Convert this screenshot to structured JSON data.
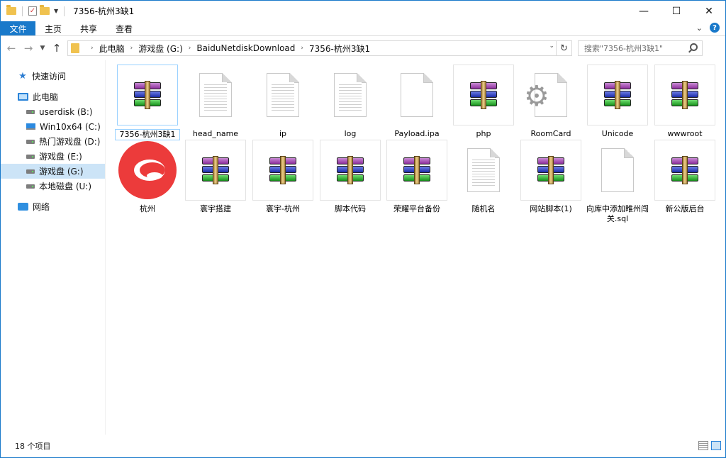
{
  "window": {
    "title": "7356-杭州3缺1",
    "controls": {
      "minimize": "—",
      "maximize": "☐",
      "close": "✕"
    }
  },
  "ribbon": {
    "tabs": [
      "文件",
      "主页",
      "共享",
      "查看"
    ],
    "expand_icon": "chevron-down-icon",
    "help": "?"
  },
  "address": {
    "crumbs": [
      "此电脑",
      "游戏盘 (G:)",
      "BaiduNetdiskDownload",
      "7356-杭州3缺1"
    ],
    "refresh_icon": "refresh-icon"
  },
  "search": {
    "placeholder": "搜索\"7356-杭州3缺1\""
  },
  "nav_pane": {
    "quick_access": "快速访问",
    "this_pc": "此电脑",
    "drives": [
      "userdisk (B:)",
      "Win10x64 (C:)",
      "热门游戏盘 (D:)",
      "游戏盘 (E:)",
      "游戏盘 (G:)",
      "本地磁盘 (U:)"
    ],
    "network": "网络"
  },
  "files": [
    {
      "name": "7356-杭州3缺1",
      "type": "rar"
    },
    {
      "name": "head_name",
      "type": "doc"
    },
    {
      "name": "ip",
      "type": "doc"
    },
    {
      "name": "log",
      "type": "doc"
    },
    {
      "name": "Payload.ipa",
      "type": "blank"
    },
    {
      "name": "php",
      "type": "rar"
    },
    {
      "name": "RoomCard",
      "type": "gear"
    },
    {
      "name": "Unicode",
      "type": "rar"
    },
    {
      "name": "wwwroot",
      "type": "rar"
    },
    {
      "name": "杭州",
      "type": "logo"
    },
    {
      "name": "寰宇搭建",
      "type": "rar"
    },
    {
      "name": "寰宇-杭州",
      "type": "rar"
    },
    {
      "name": "脚本代码",
      "type": "rar"
    },
    {
      "name": "荣耀平台备份",
      "type": "rar"
    },
    {
      "name": "随机名",
      "type": "doc"
    },
    {
      "name": "网站脚本(1)",
      "type": "rar"
    },
    {
      "name": "向库中添加睢州闯关.sql",
      "type": "blank"
    },
    {
      "name": "新公版后台",
      "type": "rar"
    }
  ],
  "status": {
    "count": "18 个项目"
  }
}
